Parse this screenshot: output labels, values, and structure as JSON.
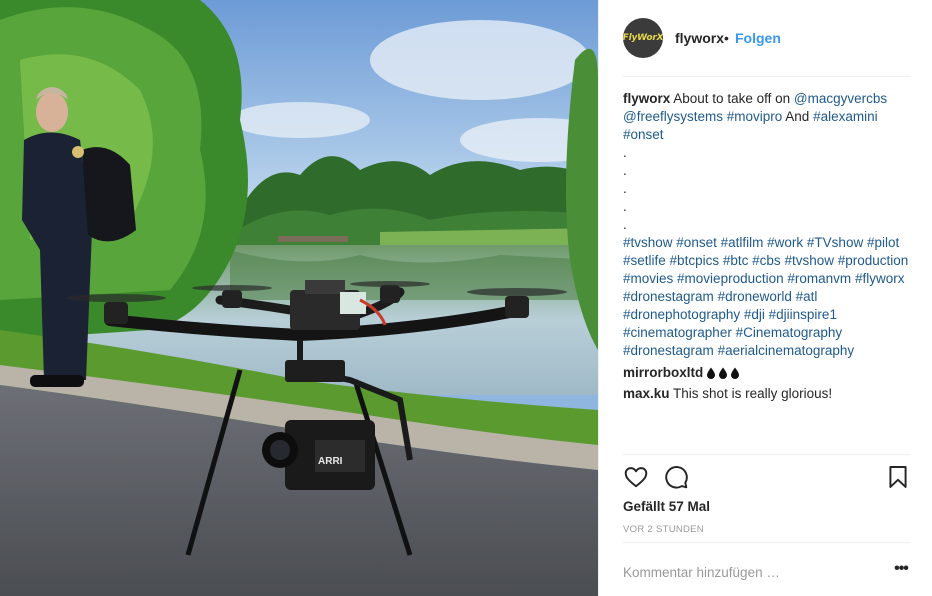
{
  "post": {
    "username": "flyworx",
    "avatar_text": "FlyWorX",
    "separator": "•",
    "follow_label": "Folgen",
    "photo_logo_text": "ARRI"
  },
  "caption": {
    "username": "flyworx",
    "segments": [
      {
        "text": "About to take off on ",
        "tag": false
      },
      {
        "text": "@macgyvercbs",
        "tag": true
      },
      {
        "text": " ",
        "tag": false
      },
      {
        "text": "@freeflysystems",
        "tag": true
      },
      {
        "text": " ",
        "tag": false
      },
      {
        "text": "#movipro",
        "tag": true
      },
      {
        "text": " And ",
        "tag": false
      },
      {
        "text": "#alexamini",
        "tag": true
      },
      {
        "text": " ",
        "tag": false
      },
      {
        "text": "#onset",
        "tag": true
      }
    ],
    "dots": [
      ".",
      ".",
      ".",
      ".",
      "."
    ],
    "hashtags": [
      "#tvshow",
      "#onset",
      "#atlfilm",
      "#work",
      "#TVshow",
      "#pilot",
      "#setlife",
      "#btcpics",
      "#btc",
      "#cbs",
      "#tvshow",
      "#production",
      "#movies",
      "#movieproduction",
      "#romanvm",
      "#flyworx",
      "#dronestagram",
      "#droneworld",
      "#atl",
      "#dronephotography",
      "#dji",
      "#djiinspire1",
      "#cinematographer",
      "#Cinematography",
      "#dronestagram",
      "#aerialcinematography"
    ]
  },
  "comments": [
    {
      "username": "mirrorboxltd",
      "text": "",
      "drops": 3
    },
    {
      "username": "max.ku",
      "text": "This shot is really glorious!",
      "drops": 0
    }
  ],
  "actions": {
    "like_icon": "heart-icon",
    "comment_icon": "comment-icon",
    "save_icon": "bookmark-icon"
  },
  "likes_text": "Gefällt 57 Mal",
  "timestamp": "VOR 2 STUNDEN",
  "comment_placeholder": "Kommentar hinzufügen …",
  "more_label": "•••",
  "colors": {
    "link": "#3897f0",
    "hashtag": "#1f5a8c",
    "muted": "#999999",
    "text": "#262626"
  }
}
